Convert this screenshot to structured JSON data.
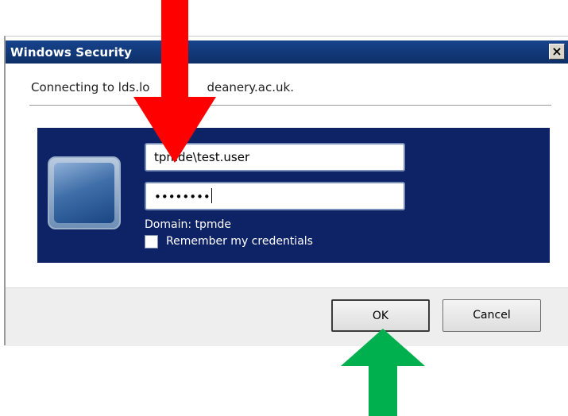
{
  "window": {
    "title": "Windows Security",
    "close_glyph": "×"
  },
  "message": "Connecting to lds.lo",
  "message_tail": "deanery.ac.uk.",
  "credentials": {
    "username_value": "tpmde\\test.user",
    "password_mask": "••••••••",
    "domain_label": "Domain: tpmde",
    "remember_label": "Remember my credentials",
    "remember_checked": false
  },
  "buttons": {
    "ok_label": "OK",
    "cancel_label": "Cancel"
  },
  "annotations": {
    "down_arrow_color": "#ff0000",
    "up_arrow_color": "#00b04f"
  },
  "icons": {
    "user_tile": "user-tile-icon"
  }
}
